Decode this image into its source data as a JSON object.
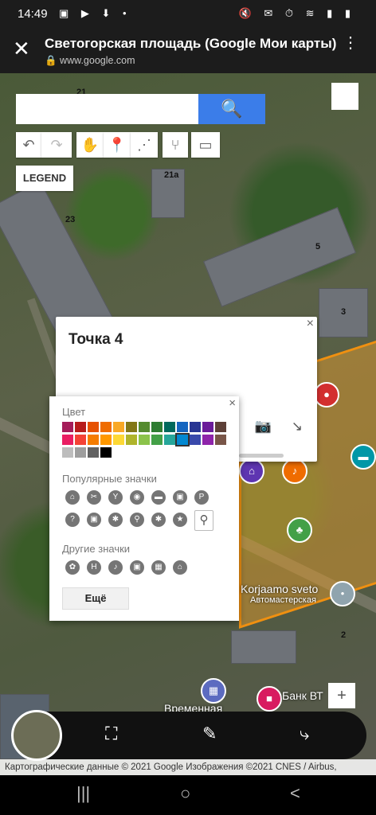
{
  "status": {
    "time": "14:49",
    "left_icons": "▣ ▶ ⬇ •",
    "right_icons": "🔇 ✉ ⏱ ≋ ▮ ▮"
  },
  "browser": {
    "close_icon": "✕",
    "title": "Светогорская площадь (Google Мои карты)",
    "url": "www.google.com",
    "menu_icon": "⋮"
  },
  "map": {
    "labels": [
      "21",
      "21a",
      "23",
      "5",
      "3",
      "2"
    ],
    "search": {
      "placeholder": "",
      "button_icon": "🔍"
    },
    "tools": [
      "↶",
      "↷",
      "✋",
      "📍",
      "⋰",
      "⑂",
      "▭"
    ],
    "legend": "LEGEND",
    "place_labels": [
      "Korjaamo sveto",
      "Автомастерская",
      "Банк ВТ",
      "Временная"
    ],
    "zoom": "+"
  },
  "info_window": {
    "title": "Точка 4",
    "close": "×",
    "tools": "◈ ✎ 📷 ↘"
  },
  "style_popup": {
    "close": "×",
    "color_header": "Цвет",
    "colors": [
      "#a51d5a",
      "#b71c1c",
      "#e65100",
      "#ef6c00",
      "#f9a825",
      "#827717",
      "#558b2f",
      "#2e7d32",
      "#00695c",
      "#1565c0",
      "#283593",
      "#6a1b9a",
      "#5d4037",
      "#e91e63",
      "#f44336",
      "#f57c00",
      "#ff9800",
      "#fdd835",
      "#afb42b",
      "#8bc34a",
      "#43a047",
      "#26a69a",
      "#0288d1",
      "#3949ab",
      "#8e24aa",
      "#795548",
      "#bdbdbd",
      "#9e9e9e",
      "#616161",
      "#000000"
    ],
    "selected_color": "#0288d1",
    "popular_header": "Популярные значки",
    "popular_icons": [
      "⌂",
      "✂",
      "Y",
      "◉",
      "▬",
      "▣",
      "P",
      "?",
      "▣",
      "✱",
      "⚲",
      "✱",
      "★",
      "⚲"
    ],
    "other_header": "Другие значки",
    "other_icons": [
      "✿",
      "H",
      "♪",
      "▣",
      "▦",
      "⌂"
    ],
    "more_button": "Ещё"
  },
  "bottom_bar": {
    "icons": [
      "⛶",
      "✎",
      "⤷"
    ]
  },
  "credits": "Картографические данные © 2021 Google Изображения ©2021 CNES / Airbus,",
  "navbar": {
    "recent": "|||",
    "home": "○",
    "back": "<"
  }
}
